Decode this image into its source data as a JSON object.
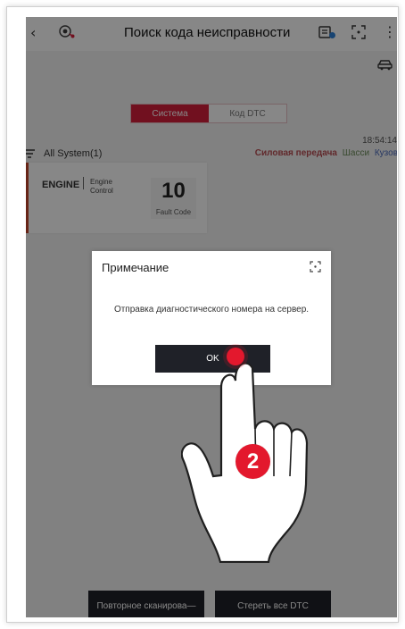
{
  "header": {
    "title": "Поиск кода неисправности",
    "icons": [
      "back-icon",
      "vci-icon",
      "doc-icon",
      "expand-icon",
      "more-icon"
    ]
  },
  "tabs": [
    {
      "label": "Система",
      "active": true
    },
    {
      "label": "Код DTC",
      "active": false
    }
  ],
  "summary": {
    "timestamp": "18:54:14",
    "system_label": "All System(1)",
    "categories": {
      "drive": "Силовая передача",
      "chassis": "Шасси",
      "body": "Кузов"
    }
  },
  "card": {
    "engine": "ENGINE",
    "engine_description": "Engine Control",
    "fault_count": "10",
    "fault_label": "Fault Code"
  },
  "dialog": {
    "title": "Примечание",
    "message": "Отправка диагностического номера на сервер.",
    "ok_label": "OK"
  },
  "bottom_buttons": {
    "rescan_label": "Повторное сканирова—",
    "clear_label": "Стереть все DTC"
  },
  "callout": {
    "step": "2"
  },
  "colors": {
    "accent_red": "#d51f3c",
    "button_dark": "#1f2128",
    "drive_color": "#b74d52",
    "chassis_color": "#6a8b58",
    "body_color": "#4767b9"
  }
}
